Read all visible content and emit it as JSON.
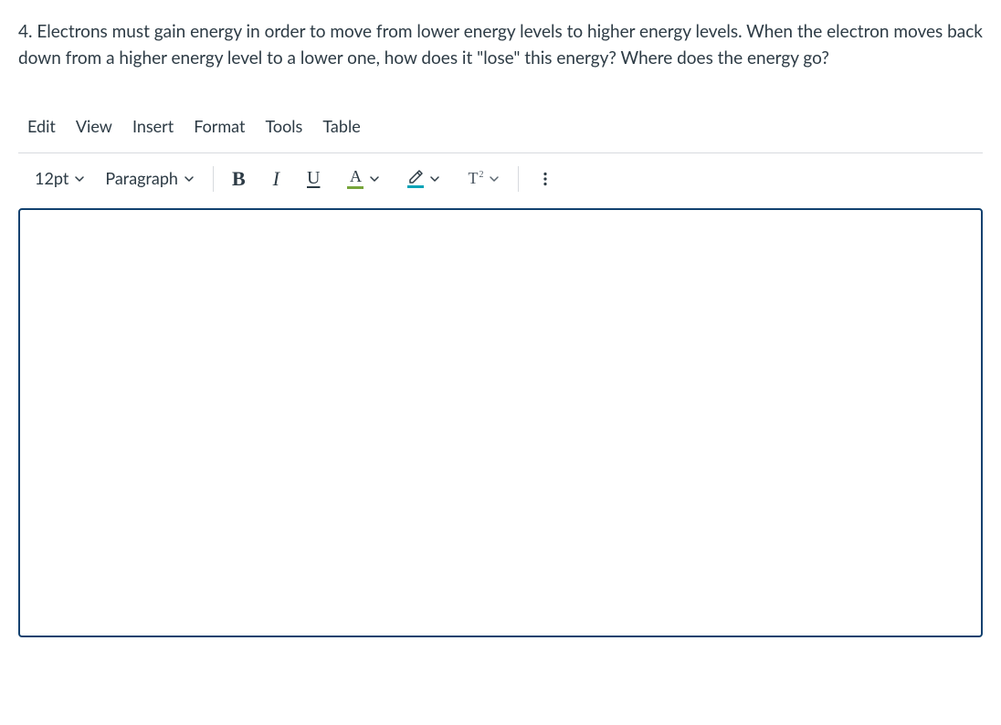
{
  "question": {
    "text": "4.  Electrons must gain energy in order to move from lower energy levels to higher energy levels.  When the electron moves back down from a higher energy level to a lower one, how does it \"lose\" this energy?  Where does the energy go?"
  },
  "menubar": {
    "edit": "Edit",
    "view": "View",
    "insert": "Insert",
    "format": "Format",
    "tools": "Tools",
    "table": "Table"
  },
  "toolbar": {
    "font_size": "12pt",
    "block_format": "Paragraph",
    "text_color_letter": "A",
    "super_t": "T",
    "super_2": "2"
  },
  "colors": {
    "text_color_underline": "#77a53b",
    "highlight_underline": "#06a3b7"
  },
  "editor": {
    "value": ""
  }
}
